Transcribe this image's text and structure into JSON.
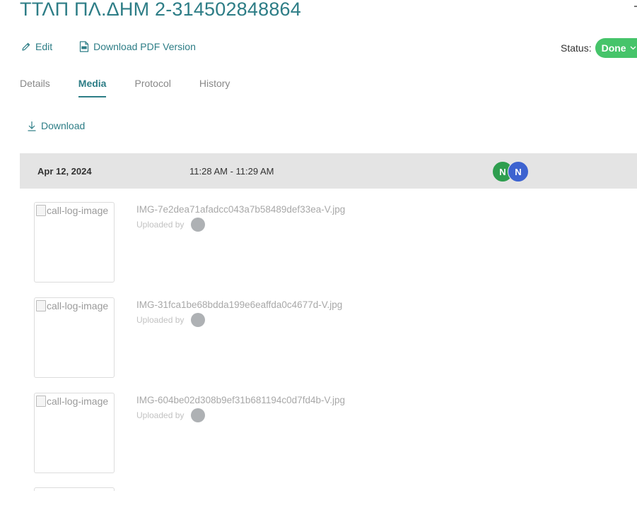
{
  "page": {
    "title": "ΤΤΛΠ ΠΛ.ΔΗΜ 2-314502848864"
  },
  "actions": {
    "edit_label": "Edit",
    "download_pdf_label": "Download PDF Version"
  },
  "status": {
    "label": "Status:",
    "value": "Done",
    "color": "#46c46a"
  },
  "tabs": [
    {
      "label": "Details",
      "active": false
    },
    {
      "label": "Media",
      "active": true
    },
    {
      "label": "Protocol",
      "active": false
    },
    {
      "label": "History",
      "active": false
    }
  ],
  "media": {
    "download_label": "Download",
    "group": {
      "date": "Apr 12, 2024",
      "time_range": "11:28 AM - 11:29 AM",
      "participants": [
        {
          "initial": "N",
          "color": "#2e9e4f"
        },
        {
          "initial": "N",
          "color": "#3d63d0"
        }
      ]
    },
    "items": [
      {
        "thumb_alt": "call-log-image",
        "filename": "IMG-7e2dea71afadcc043a7b58489def33ea-V.jpg",
        "uploaded_by_label": "Uploaded by"
      },
      {
        "thumb_alt": "call-log-image",
        "filename": "IMG-31fca1be68bdda199e6eaffda0c4677d-V.jpg",
        "uploaded_by_label": "Uploaded by"
      },
      {
        "thumb_alt": "call-log-image",
        "filename": "IMG-604be02d308b9ef31b681194c0d7fd4b-V.jpg",
        "uploaded_by_label": "Uploaded by"
      }
    ]
  },
  "colors": {
    "accent": "#2d7d86",
    "header_bg": "#e4e4e4"
  }
}
